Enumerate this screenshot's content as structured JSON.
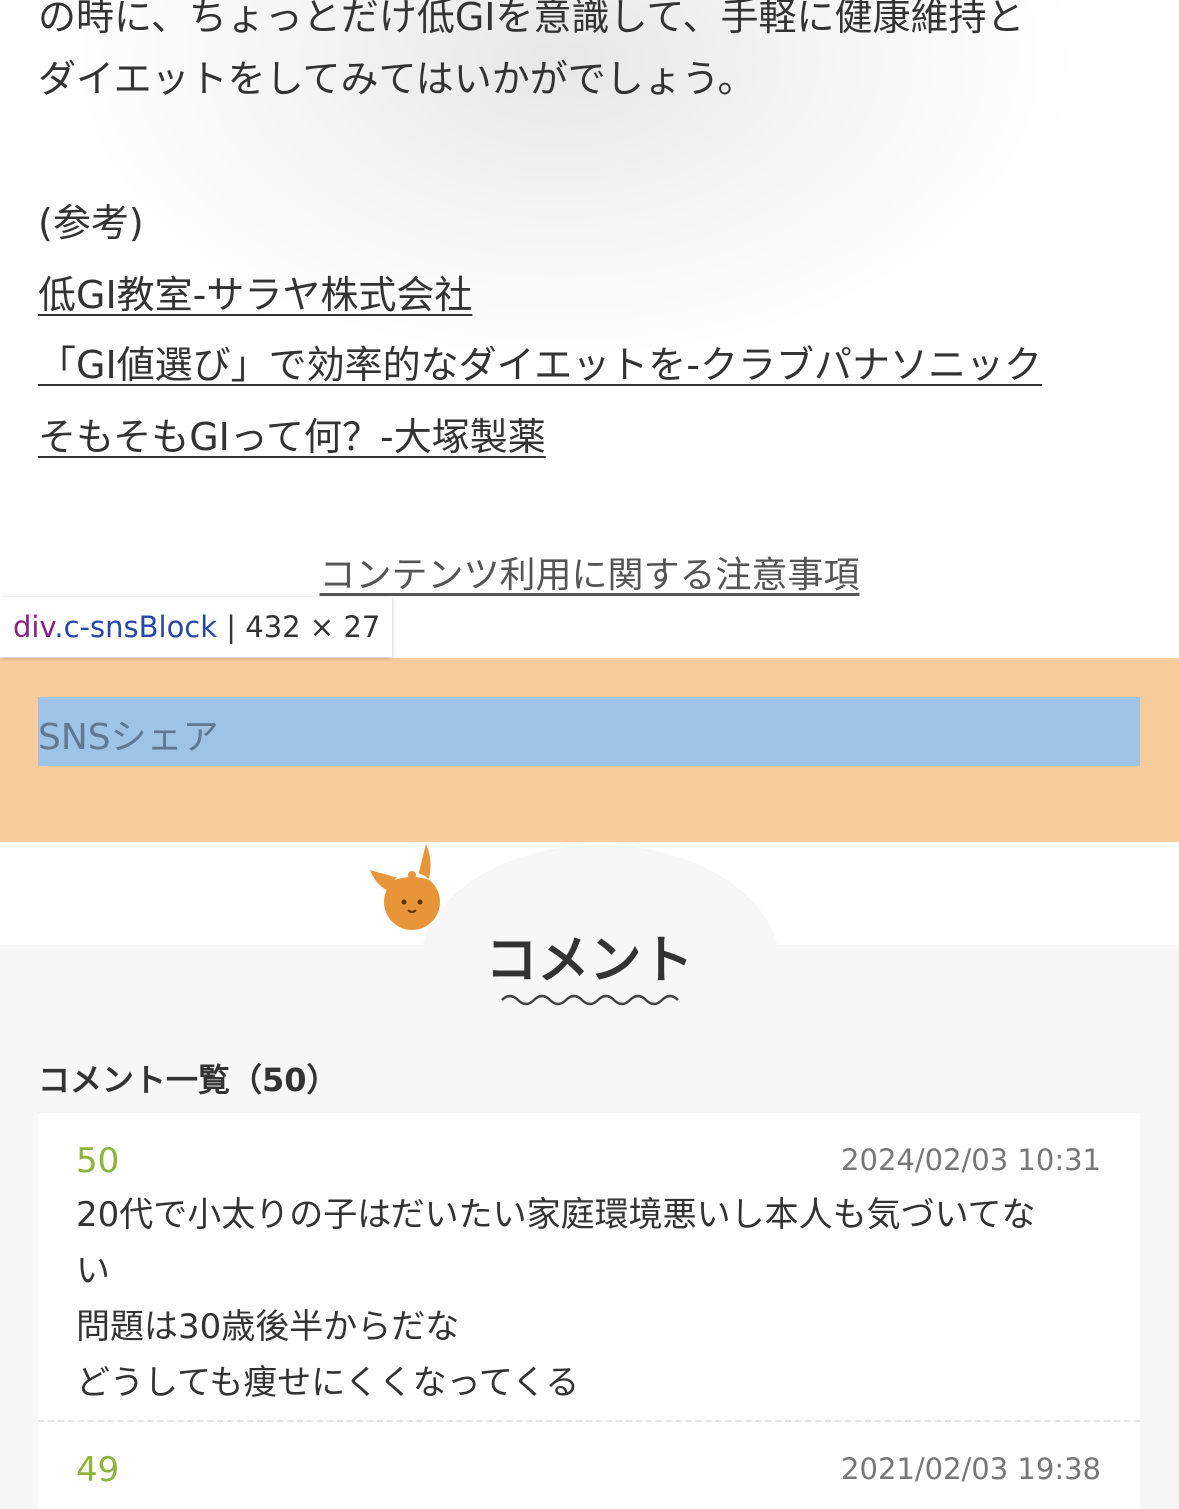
{
  "article": {
    "line1": "の時に、ちょっとだけ低GIを意識して、手軽に健康維持と",
    "line2": "ダイエットをしてみてはいかがでしょう。",
    "ref_label": "(参考)",
    "links": [
      "低GI教室-サラヤ株式会社",
      "「GI値選び」で効率的なダイエットを-クラブパナソニック",
      "そもそもGIって何？-大塚製薬"
    ],
    "notice_link": "コンテンツ利用に関する注意事項"
  },
  "devtools_tooltip": {
    "tag": "div",
    "class": ".c-snsBlock",
    "separator": " | ",
    "size": "432 × 27"
  },
  "sns": {
    "label": "SNSシェア"
  },
  "comments": {
    "title": "コメント",
    "list_heading": "コメント一覧（50）",
    "items": [
      {
        "number": "50",
        "date": "2024/02/03 10:31",
        "lines": [
          "20代で小太りの子はだいたい家庭環境悪いし本人も気づいてな",
          "い",
          "問題は30歳後半からだな",
          "どうしても痩せにくくなってくる"
        ]
      },
      {
        "number": "49",
        "date": "2021/02/03 19:38"
      }
    ]
  },
  "colors": {
    "margin_overlay": "#f8cb9c",
    "content_overlay": "#9fc3e7",
    "comment_number": "#8db43a",
    "mascot": "#e8953a"
  }
}
